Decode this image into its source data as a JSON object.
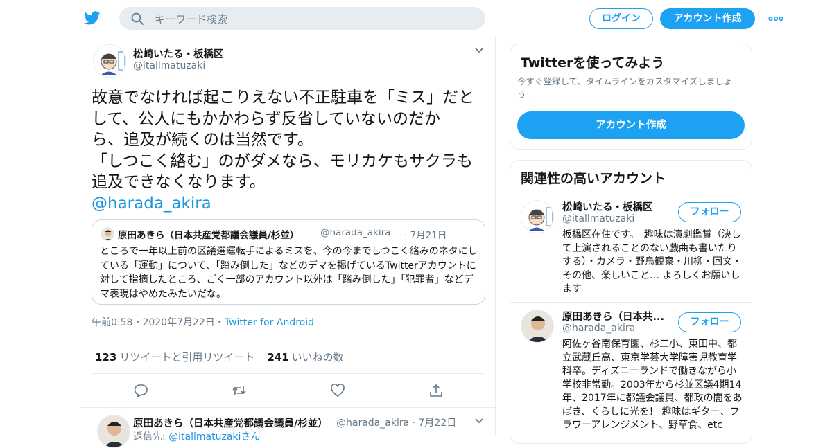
{
  "header": {
    "search_placeholder": "キーワード検索",
    "login_label": "ログイン",
    "signup_label": "アカウント作成"
  },
  "tweet": {
    "author_name": "松崎いたる・板橋区",
    "author_handle": "@itallmatuzaki",
    "text_lines": [
      "故意でなければ起こりえない不正駐車を「ミス」だと",
      "して、公人にもかかわらず反省していないのだか",
      "ら、追及が続くのは当然です。",
      "「しつこく絡む」のがダメなら、モリカケもサクラも",
      "追及できなくなります。"
    ],
    "mention": "@harada_akira",
    "quote": {
      "name": "原田あきら（日本共産党都議会議員/杉並）",
      "handle": "@harada_akira",
      "date": "· 7月21日",
      "text": "ところで一年以上前の区議選運転手によるミスを、今の今までしつこく絡みのネタにしている「運動」について、「踏み倒した」などのデマを掲げているTwitterアカウントに対して指摘したところ、ごく一部のアカウント以外は「踏み倒した」「犯罪者」などデマ表現はやめたみたいだな。"
    },
    "timestamp": "午前0:58・2020年7月22日・",
    "via": "Twitter for Android",
    "retweets_count": "123",
    "retweets_label": "リツイートと引用リツイート",
    "likes_count": "241",
    "likes_label": "いいねの数"
  },
  "reply": {
    "name": "原田あきら（日本共産党都議会議員/杉並）",
    "handle": "@harada_akira · 7月22日",
    "reply_to_prefix": "返信先: ",
    "reply_to_handle": "@itallmatuzakiさん"
  },
  "sidebar": {
    "signup_card": {
      "title": "Twitterを使ってみよう",
      "description": "今すぐ登録して、タイムラインをカスタマイズしましょう。",
      "button": "アカウント作成"
    },
    "related": {
      "title": "関連性の高いアカウント",
      "accounts": [
        {
          "name": "松崎いたる・板橋区",
          "handle": "@itallmatuzaki",
          "follow": "フォロー",
          "bio": "板橋区在住です。　趣味は演劇鑑賞（決して上演されることのない戯曲も書いたりする）・カメラ・野鳥観察・川柳・回文・その他、楽しいこと… よろしくお願いします"
        },
        {
          "name": "原田あきら（日本共...",
          "handle": "@harada_akira",
          "follow": "フォロー",
          "bio": "阿佐ヶ谷南保育園、杉二小、東田中、都立武蔵丘高、東京学芸大学障害児教育学科卒。ディズニーランドで働きながら小学校非常勤。2003年から杉並区議4期14 年、2017年に都議会議員、都政の闇をあばき、くらしに光を！ 趣味はギター、フラワーアレンジメント、野草食、etc"
        }
      ]
    }
  },
  "colors": {
    "accent": "#1da1f2",
    "link": "#1b95e0",
    "muted": "#657786",
    "border": "#e6ecf0"
  }
}
